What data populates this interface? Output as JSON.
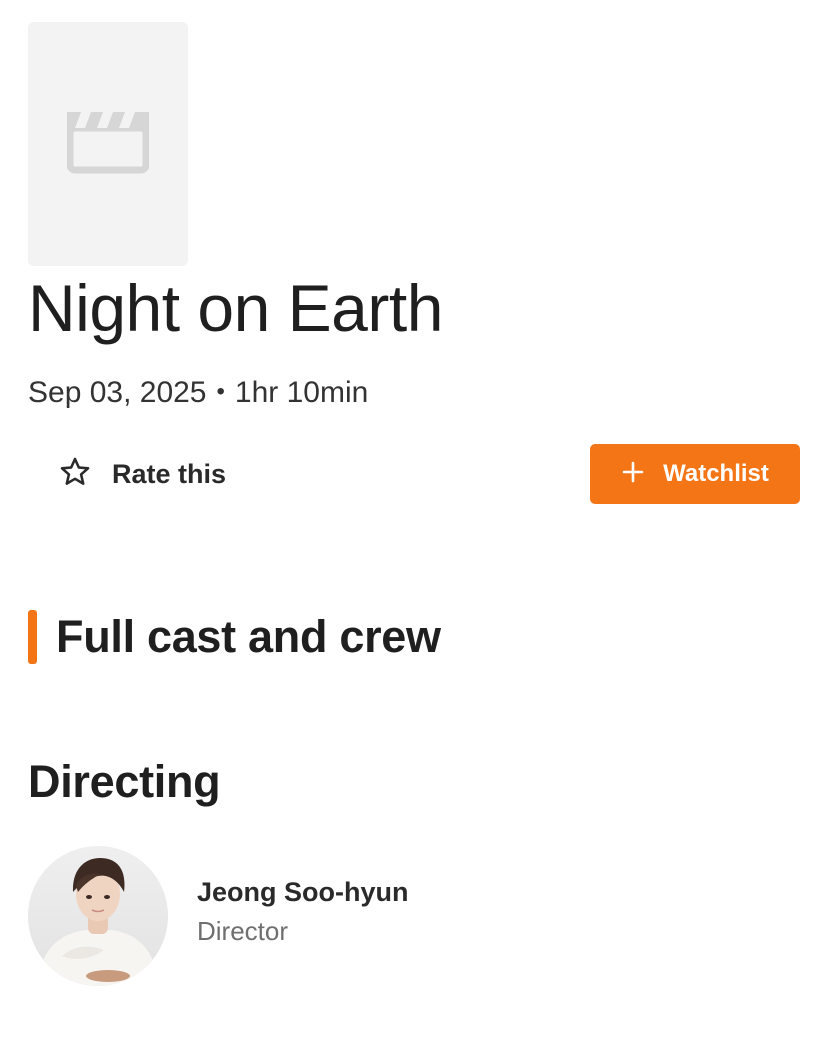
{
  "movie": {
    "poster_icon": "clapperboard-icon",
    "title": "Night on Earth",
    "release_date": "Sep 03, 2025",
    "separator": "•",
    "runtime": "1hr 10min"
  },
  "actions": {
    "rate_icon": "star-outline-icon",
    "rate_label": "Rate this",
    "watchlist_icon": "plus-icon",
    "watchlist_label": "Watchlist"
  },
  "credits": {
    "section_title": "Full cast and crew",
    "groups": [
      {
        "title": "Directing",
        "people": [
          {
            "name": "Jeong Soo-hyun",
            "role": "Director",
            "avatar": "person-photo"
          }
        ]
      }
    ]
  },
  "colors": {
    "accent": "#f47516",
    "poster_placeholder": "#f3f3f3",
    "placeholder_icon": "#d6d6d6",
    "text_primary": "#1f1f1f",
    "text_secondary": "#6f6f6f"
  }
}
